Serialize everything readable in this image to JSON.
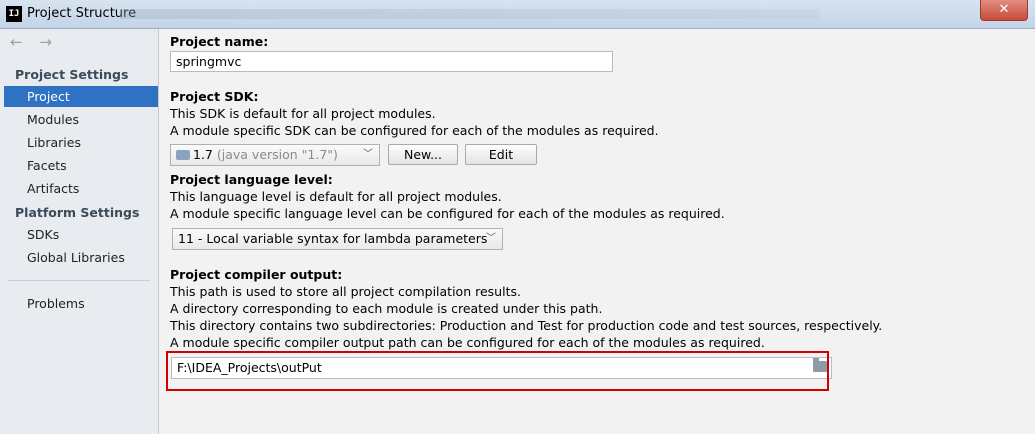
{
  "window": {
    "title": "Project Structure",
    "close_label": "✕",
    "app_icon_label": "IJ"
  },
  "sidebar": {
    "nav_arrows": "← →",
    "project_settings_title": "Project Settings",
    "platform_settings_title": "Platform Settings",
    "items": [
      {
        "label": "Project"
      },
      {
        "label": "Modules"
      },
      {
        "label": "Libraries"
      },
      {
        "label": "Facets"
      },
      {
        "label": "Artifacts"
      },
      {
        "label": "SDKs"
      },
      {
        "label": "Global Libraries"
      },
      {
        "label": "Problems"
      }
    ],
    "selected": "Project"
  },
  "project_name": {
    "label": "Project name:",
    "value": "springmvc"
  },
  "project_sdk": {
    "label": "Project SDK:",
    "line1": "This SDK is default for all project modules.",
    "line2": "A module specific SDK can be configured for each of the modules as required.",
    "selected_value": "1.7",
    "selected_detail": "(java version \"1.7\")",
    "new_button": "New...",
    "edit_button": "Edit"
  },
  "language_level": {
    "label": "Project language level:",
    "line1": "This language level is default for all project modules.",
    "line2": "A module specific language level can be configured for each of the modules as required.",
    "selected_value": "11 - Local variable syntax for lambda parameters"
  },
  "compiler_output": {
    "label": "Project compiler output:",
    "line1": "This path is used to store all project compilation results.",
    "line2": "A directory corresponding to each module is created under this path.",
    "line3": "This directory contains two subdirectories: Production and Test for production code and test sources, respectively.",
    "line4": "A module specific compiler output path can be configured for each of the modules as required.",
    "path": "F:\\IDEA_Projects\\outPut"
  },
  "colors": {
    "selection": "#2f72c4",
    "highlight_border": "#d40000"
  }
}
